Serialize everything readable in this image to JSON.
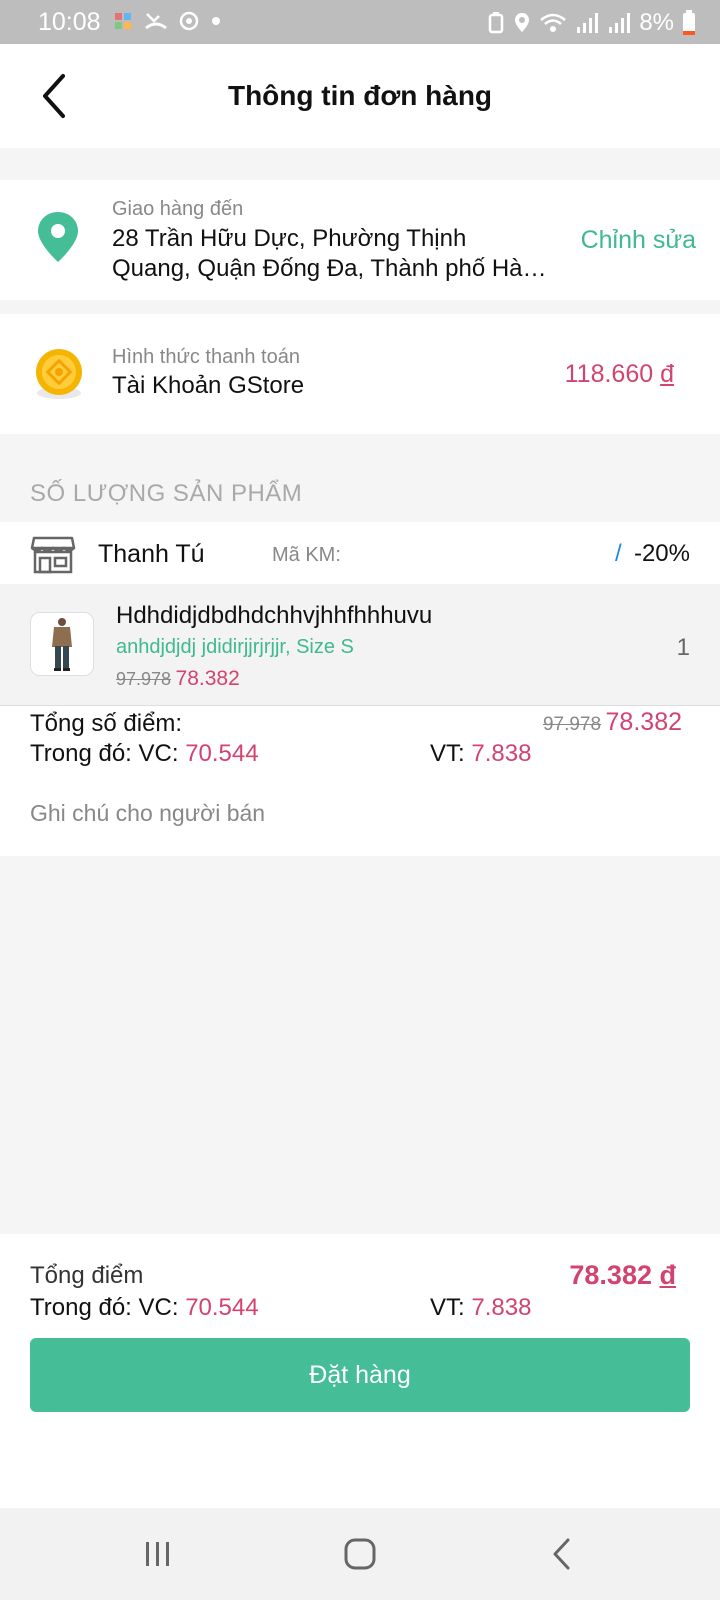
{
  "status_bar": {
    "time": "10:08",
    "battery": "8%"
  },
  "header": {
    "title": "Thông tin đơn hàng",
    "back_icon": "chevron-left-icon"
  },
  "shipping": {
    "label": "Giao hàng đến",
    "address_line1": "28 Trần Hữu Dực, Phường Thịnh",
    "address_line2": "Quang, Quận Đống Đa, Thành phố Hà Nội",
    "edit_label": "Chỉnh sửa",
    "icon": "location-pin-icon"
  },
  "payment": {
    "label": "Hình thức thanh toán",
    "method": "Tài Khoản GStore",
    "amount": "118.660",
    "currency": "đ",
    "icon": "coin-icon"
  },
  "products_section": {
    "title": "SỐ LƯỢNG SẢN PHẨM"
  },
  "shop": {
    "name": "Thanh Tú",
    "promo_label": "Mã KM:",
    "promo_slash": "/",
    "discount": "-20%",
    "icon": "store-icon"
  },
  "product": {
    "name": "Hdhdidjdbdhdchhvjhhfhhhuvu",
    "variant": "anhdjdjdj jdidirjjrjrjjr, Size S",
    "price_old": "97.978",
    "price_new": "78.382",
    "quantity": "1"
  },
  "summary": {
    "total_label": "Tổng số điểm:",
    "price_old": "97.978",
    "price_new": "78.382",
    "vc_label": "Trong đó: VC:",
    "vc_value": "70.544",
    "vt_label": "VT:",
    "vt_value": "7.838",
    "note_placeholder": "Ghi chú cho người bán"
  },
  "footer": {
    "total_label": "Tổng điểm",
    "total_amount": "78.382",
    "currency": "đ",
    "vc_label": "Trong đó: VC:",
    "vc_value": "70.544",
    "vt_label": "VT:",
    "vt_value": "7.838",
    "order_button": "Đặt hàng"
  },
  "colors": {
    "accent_green": "#45bd97",
    "price_pink": "#d2436f",
    "link_blue": "#1e88e5"
  }
}
